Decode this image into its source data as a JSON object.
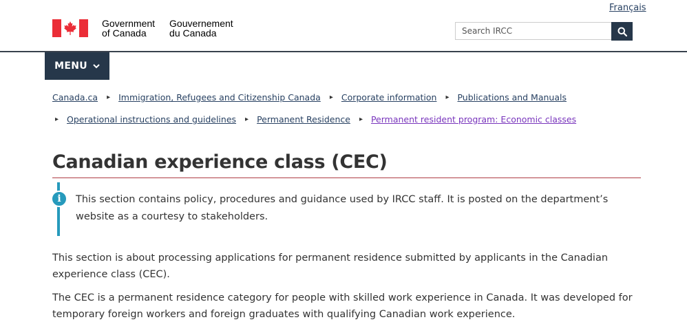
{
  "header": {
    "language_toggle": "Français",
    "wordmark": {
      "en_line1": "Government",
      "en_line2": "of Canada",
      "fr_line1": "Gouvernement",
      "fr_line2": "du Canada"
    },
    "search": {
      "placeholder": "Search IRCC",
      "button_icon": "search-icon"
    },
    "menu_label": "MENU"
  },
  "breadcrumb": {
    "row1": [
      "Canada.ca",
      "Immigration, Refugees and Citizenship Canada",
      "Corporate information",
      "Publications and Manuals"
    ],
    "row2": [
      "Operational instructions and guidelines",
      "Permanent Residence",
      "Permanent resident program: Economic classes"
    ]
  },
  "page": {
    "title": "Canadian experience class (CEC)",
    "alert_text": "This section contains policy, procedures and guidance used by IRCC staff. It is posted on the department’s website as a courtesy to stakeholders.",
    "paragraphs": [
      "This section is about processing applications for permanent residence submitted by applicants in the Canadian experience class (CEC).",
      "The CEC is a permanent residence category for people with skilled work experience in Canada. It was developed for temporary foreign workers and foreign graduates with qualifying Canadian work experience."
    ]
  },
  "colors": {
    "flag_red": "#eb2d37",
    "nav_dark": "#26374a",
    "link": "#284162",
    "visited_link": "#7834bc",
    "title_rule": "#af3c43",
    "info_accent": "#269abc"
  }
}
